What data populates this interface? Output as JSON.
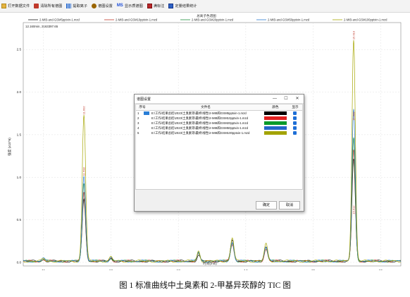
{
  "toolbar": {
    "items": [
      {
        "label": "打开数据文件",
        "icon": "folder-icon"
      },
      {
        "label": "清除所有谱图",
        "icon": "trash-icon"
      },
      {
        "label": "提取离子",
        "icon": "bar-chart-icon"
      },
      {
        "label": "谱图设置",
        "icon": "gear-icon"
      },
      {
        "label": "显示质谱图",
        "icon": "ms-icon"
      },
      {
        "label": "满标注",
        "icon": "grid-icon"
      },
      {
        "label": "定量结果统计",
        "icon": "table-icon"
      }
    ]
  },
  "chart": {
    "title": "总离子色谱图",
    "readout": "12.160min, 2163397.65",
    "x_axis_label": "时间(min)",
    "y_axis_label": "强度 (x10^6)"
  },
  "chart_data": {
    "type": "line",
    "title": "总离子色谱图",
    "xlabel": "时间(min)",
    "ylabel": "强度 (x10^6)",
    "xlim": [
      10.7,
      16.3
    ],
    "ylim": [
      0,
      2.75
    ],
    "x_ticks": [
      "11",
      "12",
      "13",
      "14",
      "15",
      "16"
    ],
    "y_ticks": [
      "0.0",
      "0.5",
      "1.0",
      "1.5",
      "2.0",
      "2.5"
    ],
    "legend_position": "top",
    "series": [
      {
        "name": "2-MIB-and-GSM5pptxin-1.mzd",
        "color": "#1a1a1a",
        "peaks": [
          [
            11.6,
            0.72
          ],
          [
            13.8,
            0.24
          ],
          [
            14.3,
            0.18
          ],
          [
            15.6,
            1.2
          ]
        ]
      },
      {
        "name": "2-MIB-and-GSM10pptxin-1.mzd",
        "color": "#c0392b",
        "peaks": [
          [
            11.6,
            0.82
          ],
          [
            13.8,
            0.2
          ],
          [
            14.3,
            0.14
          ],
          [
            15.6,
            1.3
          ]
        ]
      },
      {
        "name": "2-MIB-and-GSM20pptxin-1.mzd",
        "color": "#1e8e3e",
        "peaks": [
          [
            11.6,
            0.92
          ],
          [
            13.8,
            0.22
          ],
          [
            14.3,
            0.16
          ],
          [
            15.6,
            1.45
          ]
        ]
      },
      {
        "name": "2-MIB-and-GSM50pptxin-1.mzd",
        "color": "#2b7bd0",
        "peaks": [
          [
            11.6,
            1.0
          ],
          [
            13.8,
            0.22
          ],
          [
            14.3,
            0.16
          ],
          [
            15.6,
            1.8
          ]
        ]
      },
      {
        "name": "2-MIB-and-GSM100pptxin-1.mzd",
        "color": "#a6a600",
        "peaks": [
          [
            11.6,
            1.72
          ],
          [
            13.8,
            0.28
          ],
          [
            14.3,
            0.2
          ],
          [
            15.6,
            2.6
          ]
        ]
      }
    ],
    "small_peaks": [
      [
        12.0,
        0.05
      ],
      [
        13.3,
        0.12
      ],
      [
        11.0,
        0.03
      ]
    ],
    "peak_labels": [
      {
        "x": 11.6,
        "y": 1.72,
        "text": "11.602"
      },
      {
        "x": 11.6,
        "y": 1.0,
        "text": "11.598"
      },
      {
        "x": 15.6,
        "y": 2.6,
        "text": "15.610"
      },
      {
        "x": 15.6,
        "y": 1.65,
        "text": "15.609"
      },
      {
        "x": 15.6,
        "y": 0.55,
        "text": "15.612"
      }
    ]
  },
  "dialog": {
    "title": "谱图设置",
    "controls": [
      "—",
      "☐",
      "✕"
    ],
    "columns": [
      "序号",
      "文件名",
      "颜色",
      "显示"
    ],
    "rows": [
      {
        "index": "1",
        "file": "E:\\工作\\结果总结\\2023\\土臭素等\\最终\\线性\\2-MIB和GSM5pptxin-1.mzd",
        "color": "#000000",
        "shown": true
      },
      {
        "index": "2",
        "file": "E:\\工作\\结果总结\\2023\\土臭素等\\最终\\线性\\2-MIB和GSM10pptxin-1.mzd",
        "color": "#e02020",
        "shown": true
      },
      {
        "index": "3",
        "file": "E:\\工作\\结果总结\\2023\\土臭素等\\最终\\线性\\2-MIB和GSM20pptxin-1.mzd",
        "color": "#0a9a2a",
        "shown": true
      },
      {
        "index": "4",
        "file": "E:\\工作\\结果总结\\2023\\土臭素等\\最终\\线性\\2-MIB和GSM50pptxin-1.mzd",
        "color": "#2366c8",
        "shown": true
      },
      {
        "index": "5",
        "file": "E:\\工作\\结果总结\\2023\\土臭素等\\最终\\线性\\2-MIB和GSM100pptxin-1.mzd",
        "color": "#a3a300",
        "shown": true
      }
    ],
    "ok_label": "确定",
    "cancel_label": "取消"
  },
  "caption": "图 1  标准曲线中土臭素和 2-甲基异莰醇的 TIC 图"
}
